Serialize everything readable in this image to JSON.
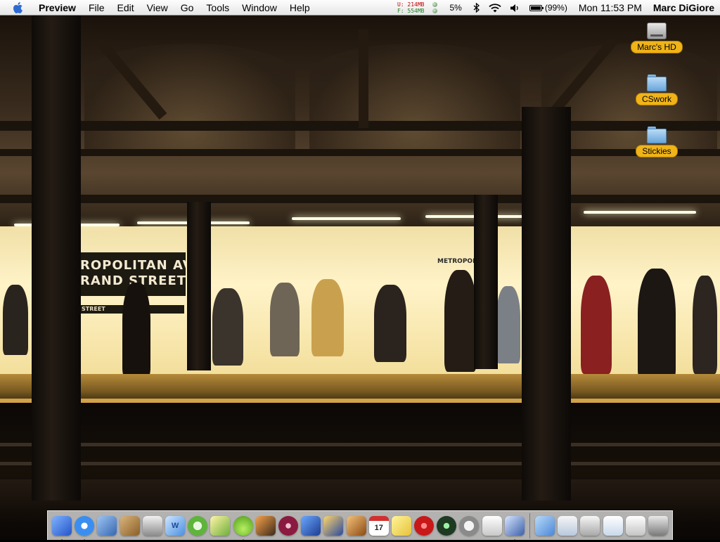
{
  "menubar": {
    "app_name": "Preview",
    "menus": [
      "File",
      "Edit",
      "View",
      "Go",
      "Tools",
      "Window",
      "Help"
    ],
    "memory_used": "U: 214MB",
    "memory_free": "F: 554MB",
    "cpu_percent": "5%",
    "battery_percent": "(99%)",
    "battery_level": 0.99,
    "clock": "Mon 11:53 PM",
    "user": "Marc DiGiore"
  },
  "desktop": {
    "icons": [
      {
        "label": "Marc's HD",
        "icon": "hard-drive-icon"
      },
      {
        "label": "CSwork",
        "icon": "folder-icon"
      },
      {
        "label": "Stickies",
        "icon": "folder-icon"
      }
    ],
    "wallpaper": {
      "sign_main": "ROPOLITAN AV\nRAND STREET",
      "sign_small": "STREET",
      "sign_right": "METROPOLITAN"
    }
  },
  "dock": {
    "apps": [
      {
        "name": "finder-icon",
        "running": true
      },
      {
        "name": "safari-icon",
        "running": true
      },
      {
        "name": "mail-icon",
        "running": false
      },
      {
        "name": "address-book-icon",
        "running": false
      },
      {
        "name": "keyboard-icon",
        "running": false
      },
      {
        "name": "dictionary-icon",
        "running": false
      },
      {
        "name": "itunes-icon",
        "running": false
      },
      {
        "name": "pencil-icon",
        "running": false
      },
      {
        "name": "flask-icon",
        "running": true
      },
      {
        "name": "iphoto-icon",
        "running": false
      },
      {
        "name": "dvd-icon",
        "running": false
      },
      {
        "name": "imovie-icon",
        "running": false
      },
      {
        "name": "clapper-icon",
        "running": false
      },
      {
        "name": "garageband-icon",
        "running": false
      },
      {
        "name": "ical-icon",
        "running": false
      },
      {
        "name": "stickies-icon",
        "running": false
      },
      {
        "name": "target-icon",
        "running": false
      },
      {
        "name": "camera-icon",
        "running": false
      },
      {
        "name": "sync-icon",
        "running": false
      },
      {
        "name": "apple-icon",
        "running": false
      },
      {
        "name": "preview-icon",
        "running": true
      }
    ],
    "docs": [
      {
        "name": "applications-folder-icon"
      },
      {
        "name": "window-thumbnail-icon"
      },
      {
        "name": "window-thumbnail-icon"
      },
      {
        "name": "window-thumbnail-icon"
      },
      {
        "name": "window-thumbnail-icon"
      },
      {
        "name": "trash-icon"
      }
    ],
    "ical_day": "17"
  }
}
